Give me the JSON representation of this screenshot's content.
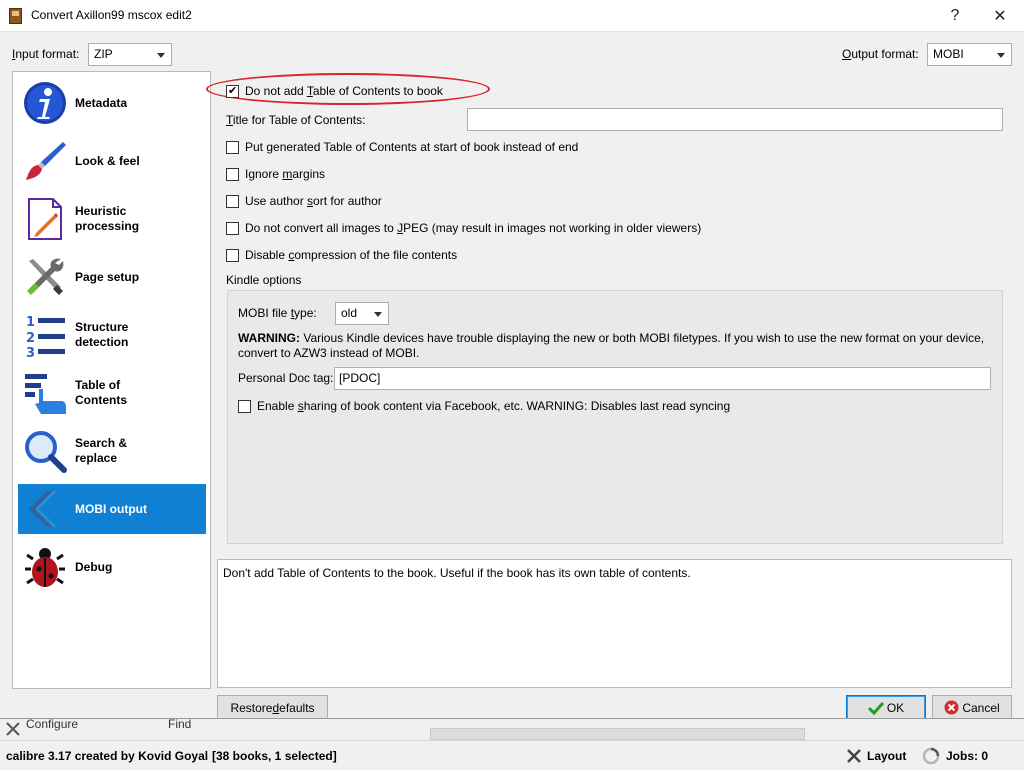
{
  "window": {
    "title": "Convert Axillon99 mscox edit2",
    "help_glyph": "?",
    "close_glyph": "✕"
  },
  "formats": {
    "input_label_prefix": "I",
    "input_label_rest": "nput format:",
    "input_value": "ZIP",
    "output_label_prefix": "O",
    "output_label_rest": "utput format:",
    "output_value": "MOBI"
  },
  "sidebar": {
    "items": [
      {
        "label1": "Metadata",
        "label2": "",
        "icon": "info-icon",
        "selected": false
      },
      {
        "label1": "Look & feel",
        "label2": "",
        "icon": "paintbrush-icon",
        "selected": false
      },
      {
        "label1": "Heuristic",
        "label2": "processing",
        "icon": "pencil-document-icon",
        "selected": false
      },
      {
        "label1": "Page setup",
        "label2": "",
        "icon": "tools-icon",
        "selected": false
      },
      {
        "label1": "Structure",
        "label2": "detection",
        "icon": "numbered-list-icon",
        "selected": false
      },
      {
        "label1": "Table of",
        "label2": "Contents",
        "icon": "toc-pointer-icon",
        "selected": false
      },
      {
        "label1": "Search &",
        "label2": "replace",
        "icon": "magnifier-icon",
        "selected": false
      },
      {
        "label1": "MOBI output",
        "label2": "",
        "icon": "chevron-left-icon",
        "selected": true
      },
      {
        "label1": "Debug",
        "label2": "",
        "icon": "bug-icon",
        "selected": false
      }
    ]
  },
  "options": {
    "no_toc": {
      "pre": "Do not add ",
      "key": "T",
      "post": "able of Contents to book",
      "checked": true
    },
    "toc_title_pre": "",
    "toc_title_key": "T",
    "toc_title_post": "itle for Table of Contents:",
    "toc_title_value": "",
    "toc_at_start": {
      "pre": "Put generated Table of Contents at start of book instead of end",
      "key": "",
      "post": "",
      "checked": false
    },
    "ignore_margins": {
      "pre": "Ignore ",
      "key": "m",
      "post": "argins",
      "checked": false
    },
    "author_sort": {
      "pre": "Use author ",
      "key": "s",
      "post": "ort for author",
      "checked": false
    },
    "no_jpeg": {
      "pre": "Do not convert all images to ",
      "key": "J",
      "post": "PEG (may result in images not working in older viewers)",
      "checked": false
    },
    "no_compression": {
      "pre": "Disable ",
      "key": "c",
      "post": "ompression of the file contents",
      "checked": false
    }
  },
  "kindle": {
    "section_label": "Kindle options",
    "file_type_pre": "MOBI file ",
    "file_type_key": "t",
    "file_type_post": "ype:",
    "file_type_value": "old",
    "warning_bold": "WARNING:",
    "warning_line1": " Various Kindle devices have trouble displaying the new or both MOBI filetypes. If you wish to use the new format on your device,",
    "warning_line2": "convert to AZW3 instead of MOBI.",
    "doc_tag_label": "Personal Doc tag:",
    "doc_tag_value": "[PDOC]",
    "share": {
      "pre": "Enable ",
      "key": "s",
      "post": "haring of book content via Facebook, etc. WARNING: Disables last read syncing",
      "checked": false
    }
  },
  "help_text": "Don't add Table of Contents to the book. Useful if the book has its own table of contents.",
  "buttons": {
    "restore_pre": "Restore ",
    "restore_key": "d",
    "restore_post": "efaults",
    "ok": "OK",
    "cancel": "Cancel"
  },
  "background": {
    "configure_peek": "Configure",
    "find_peek": "Find"
  },
  "statusbar": {
    "created_by": "calibre 3.17 created by Kovid Goyal",
    "books": "[38 books, 1 selected]",
    "layout": "Layout",
    "jobs": "Jobs: 0"
  },
  "colors": {
    "selected_nav": "#0f80d4",
    "annotation_circle": "#d8242a",
    "ok_check": "#1f9e2a",
    "cancel_icon": "#d42a2a"
  }
}
